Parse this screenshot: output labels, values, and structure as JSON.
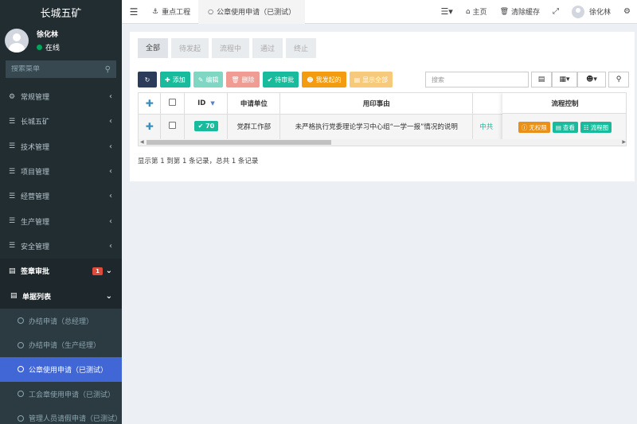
{
  "app": {
    "title": "长城五矿"
  },
  "user": {
    "name": "徐化林",
    "status": "在线"
  },
  "sidebar": {
    "search_placeholder": "搜索菜单",
    "items": [
      {
        "label": "常规管理",
        "icon": "cogs-icon"
      },
      {
        "label": "长城五矿",
        "icon": "list-icon"
      },
      {
        "label": "技术管理",
        "icon": "list-icon"
      },
      {
        "label": "项目管理",
        "icon": "list-icon"
      },
      {
        "label": "经营管理",
        "icon": "list-icon"
      },
      {
        "label": "生产管理",
        "icon": "list-icon"
      },
      {
        "label": "安全管理",
        "icon": "list-icon"
      }
    ],
    "open_group": {
      "label": "签章审批",
      "badge": "1"
    },
    "sub_parent": {
      "label": "单据列表"
    },
    "sub_items": [
      {
        "label": "办结申请（总经理）"
      },
      {
        "label": "办结申请（生产经理）"
      },
      {
        "label": "公章使用申请（已测试）"
      },
      {
        "label": "工会章使用申请（已测试）"
      },
      {
        "label": "管理人员请假申请（已测试）"
      }
    ]
  },
  "topnav": {
    "tab_key": "重点工程",
    "tab_seal": "公章使用申请（已测试）",
    "home": "主页",
    "clear_cache": "清除缓存",
    "user_name": "徐化林"
  },
  "filters": [
    "全部",
    "待发起",
    "流程中",
    "通过",
    "终止"
  ],
  "toolbar": {
    "add": "添加",
    "edit": "编辑",
    "delete": "删除",
    "pending": "待审批",
    "mine": "我发起的",
    "show_all": "显示全部",
    "search_placeholder": "搜索"
  },
  "table": {
    "headers": {
      "id": "ID",
      "unit": "申请单位",
      "reason": "用印事由",
      "flow": "流程控制"
    },
    "rows": [
      {
        "id": "70",
        "unit": "党群工作部",
        "reason": "未严格执行党委理论学习中心组“一学一报”情况的说明",
        "extra": "中共"
      }
    ],
    "actions": {
      "no_permission": "无权限",
      "view": "查看",
      "flowchart": "流程图"
    }
  },
  "pagination": {
    "info": "显示第 1 到第 1 条记录，总共 1 条记录"
  },
  "colors": {
    "sidebar_bg": "#222d32",
    "accent": "#18bc9c",
    "active_menu": "#4166d5",
    "warning": "#f39c12",
    "danger": "#dd4b39"
  }
}
